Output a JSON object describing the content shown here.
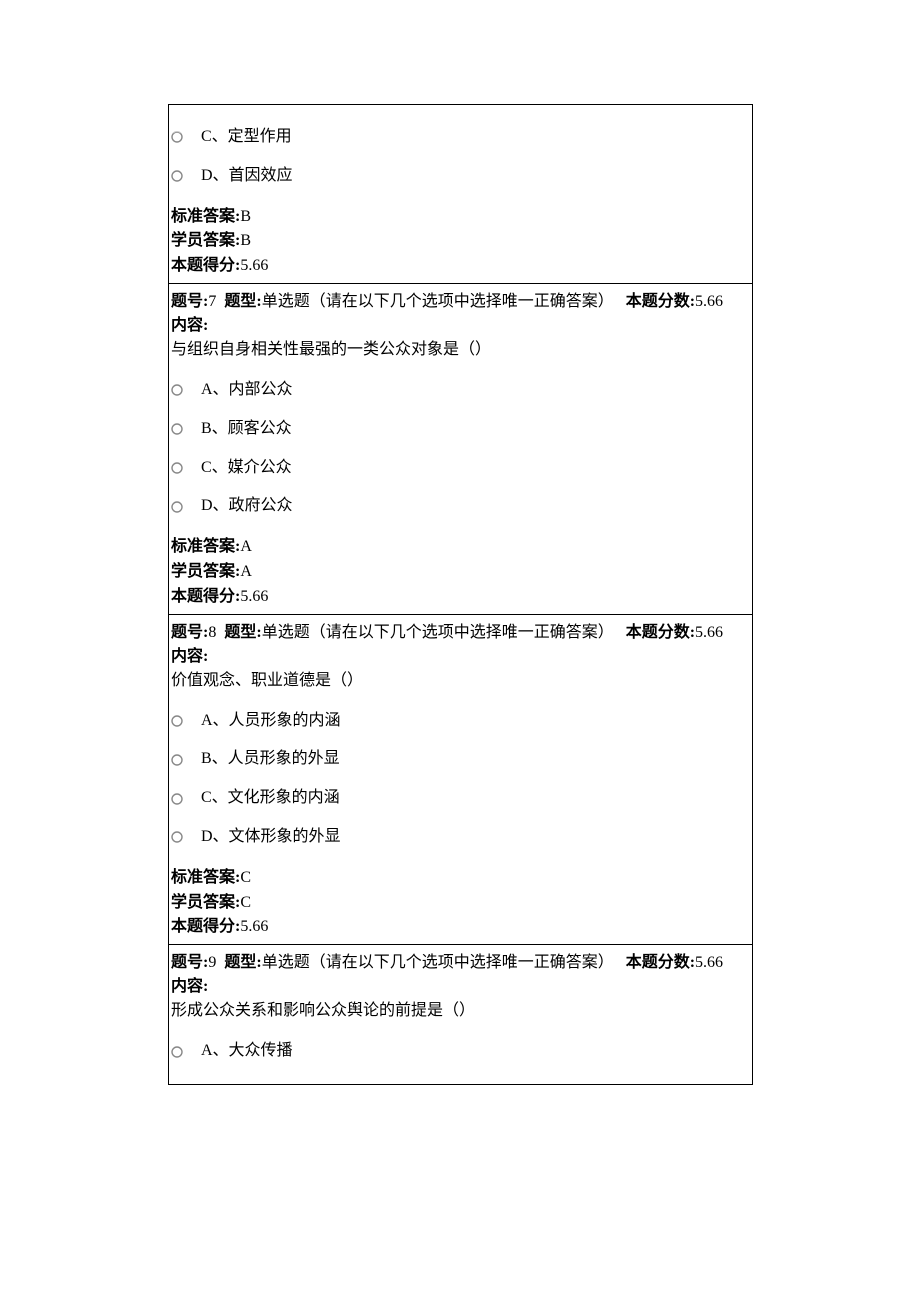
{
  "labels": {
    "question_no": "题号:",
    "question_type_label": "题型:",
    "question_type_value": "单选题（请在以下几个选项中选择唯一正确答案）",
    "score_label": "本题分数:",
    "content_label": "内容:",
    "std_answer_label": "标准答案:",
    "stu_answer_label": "学员答案:",
    "earned_label": "本题得分:"
  },
  "cell0": {
    "options": [
      "C、定型作用",
      "D、首因效应"
    ],
    "std_answer": "B",
    "stu_answer": "B",
    "earned": "5.66"
  },
  "q7": {
    "num": "7",
    "score": "5.66",
    "text": "与组织自身相关性最强的一类公众对象是（）",
    "options": [
      "A、内部公众",
      "B、顾客公众",
      "C、媒介公众",
      "D、政府公众"
    ],
    "std_answer": "A",
    "stu_answer": "A",
    "earned": "5.66"
  },
  "q8": {
    "num": "8",
    "score": "5.66",
    "text": "价值观念、职业道德是（）",
    "options": [
      "A、人员形象的内涵",
      "B、人员形象的外显",
      "C、文化形象的内涵",
      "D、文体形象的外显"
    ],
    "std_answer": "C",
    "stu_answer": "C",
    "earned": "5.66"
  },
  "q9": {
    "num": "9",
    "score": "5.66",
    "text": "形成公众关系和影响公众舆论的前提是（）",
    "options": [
      "A、大众传播"
    ]
  }
}
